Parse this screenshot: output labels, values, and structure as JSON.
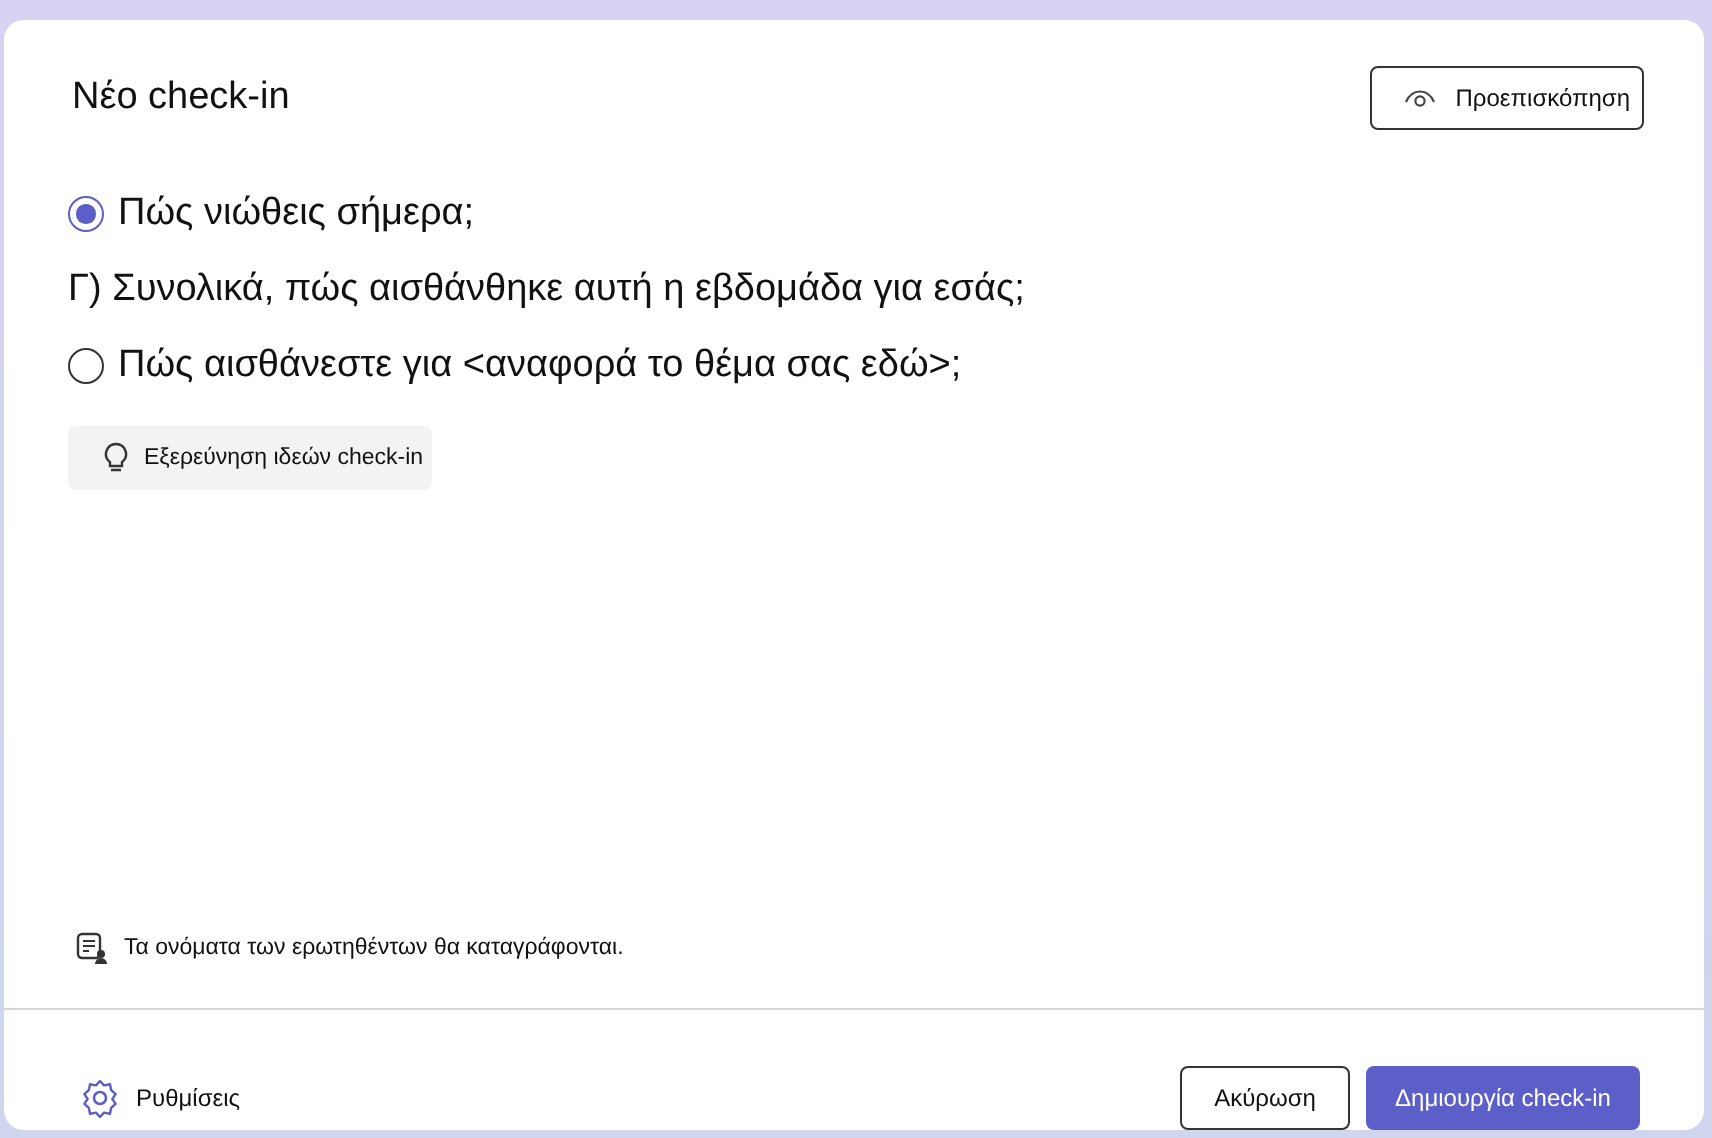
{
  "dialog": {
    "title": "Νέο check-in",
    "preview_button": "Προεπισκόπηση"
  },
  "questions": [
    {
      "kind": "radio",
      "label": "Πώς νιώθεις σήμερα;",
      "selected": true
    },
    {
      "kind": "text",
      "label": "Γ) Συνολικά, πώς αισθάνθηκε αυτή η εβδομάδα για εσάς;"
    },
    {
      "kind": "radio",
      "label": "Πώς αισθάνεστε για <αναφορά το θέμα σας εδώ>;",
      "selected": false
    }
  ],
  "explore_button": "Εξερεύνηση ιδεών check-in",
  "note": "Τα ονόματα των ερωτηθέντων θα καταγράφονται.",
  "footer": {
    "settings": "Ρυθμίσεις",
    "cancel_button": "Ακύρωση",
    "create_button": "Δημιουργία check-in"
  }
}
